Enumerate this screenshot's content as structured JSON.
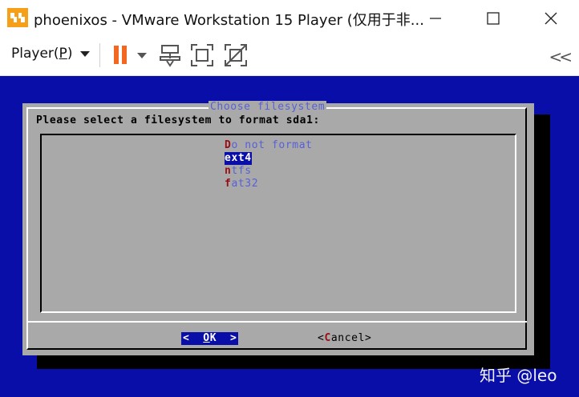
{
  "window": {
    "title": "phoenixos - VMware Workstation 15 Player (仅用于非..."
  },
  "toolbar": {
    "player_menu_prefix": "Player(",
    "player_menu_hotkey": "P",
    "player_menu_suffix": ")",
    "pause_color": "#f26722",
    "collapse_glyph": "<<"
  },
  "dialog": {
    "title": "Choose filesystem",
    "prompt": "Please select a filesystem to format sda1:",
    "options": [
      {
        "hotkey": "D",
        "rest": "o not format",
        "selected": false
      },
      {
        "hotkey": "e",
        "rest": "xt4",
        "selected": true
      },
      {
        "hotkey": "n",
        "rest": "tfs",
        "selected": false
      },
      {
        "hotkey": "f",
        "rest": "at32",
        "selected": false
      }
    ],
    "ok_left": "<  ",
    "ok_hotkey": "O",
    "ok_rest": "K",
    "ok_right": "  >",
    "cancel_left": "<",
    "cancel_hotkey": "C",
    "cancel_rest": "ancel>"
  },
  "watermark": "知乎 @leo",
  "colors": {
    "console_bg": "#0a0ea8",
    "dialog_bg": "#a9a9a9",
    "option_text": "#5860d8",
    "hotkey": "#9c0b14"
  }
}
